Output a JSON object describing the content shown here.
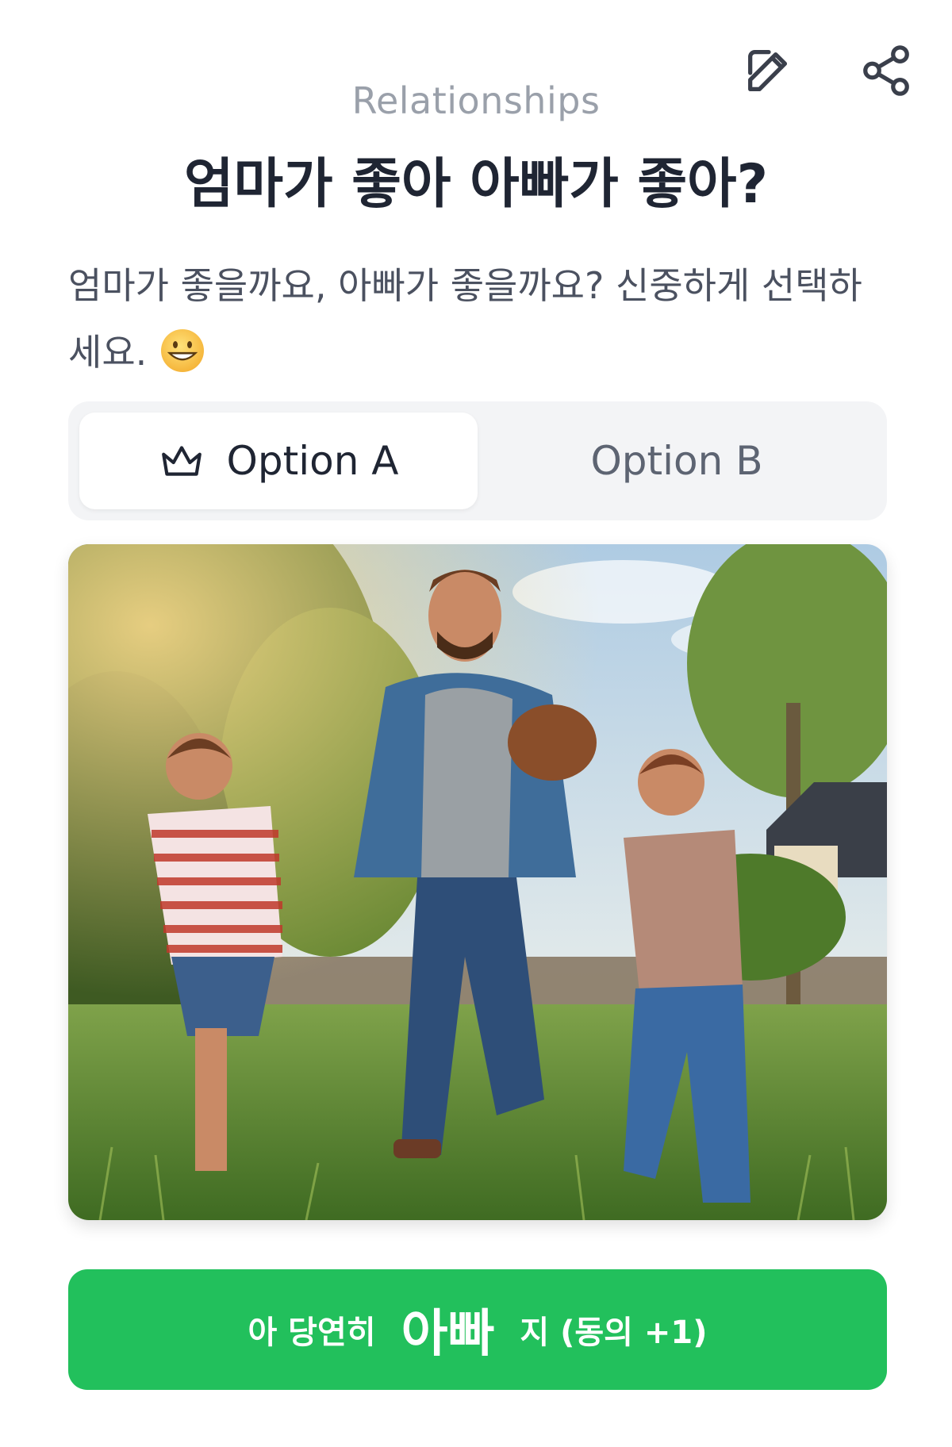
{
  "header": {
    "category": "Relationships",
    "title": "엄마가 좋아 아빠가 좋아?",
    "description": "엄마가 좋을까요, 아빠가 좋을까요? 신중하게 선택하세요.",
    "edit_icon": "edit-icon",
    "share_icon": "share-icon"
  },
  "tabs": [
    {
      "label": "Option A",
      "icon": "crown-icon",
      "selected": true
    },
    {
      "label": "Option B",
      "selected": false
    }
  ],
  "image": {
    "subject": "father running with two boys and a football in a grassy field"
  },
  "vote": {
    "prefix": "아 당연히",
    "emphasis": "아빠",
    "suffix": "지 (동의 +1)",
    "color": "#22c05c"
  },
  "colors": {
    "title": "#1f2533",
    "category": "#9aa0aa",
    "text": "#4b5160",
    "toggle_bg": "#f3f4f6"
  }
}
